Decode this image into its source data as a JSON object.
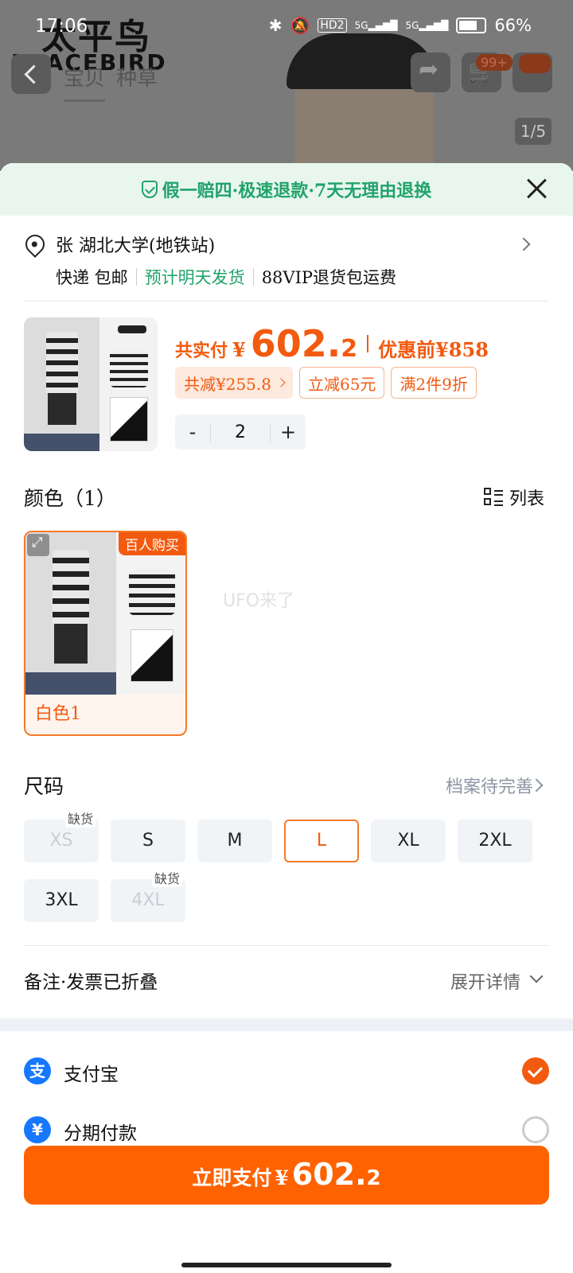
{
  "status_bar": {
    "time": "17:06",
    "battery": "66%",
    "network_labels": [
      "HD2",
      "5G",
      "5G"
    ]
  },
  "background_page": {
    "brand_cn": "太平鸟",
    "brand_en": "PEACEBIRD",
    "tabs": [
      "宝贝",
      "种草"
    ],
    "cart_badge": "99+",
    "image_pager": "1/5"
  },
  "sheet": {
    "guarantee": "假一赔四·极速退款·7天无理由退换",
    "address": {
      "name_and_location": "张 湖北大学(地铁站)",
      "delivery": "快递 包邮",
      "ship_estimate": "预计明天发货",
      "return_policy": "88VIP退货包运费"
    },
    "product": {
      "total_label": "共实付",
      "currency": "¥",
      "total_integer": "602.",
      "total_decimal": "2",
      "original_label": "优惠前",
      "original_price": "¥858",
      "promos": [
        "共减¥255.8",
        "立减65元",
        "满2件9折"
      ],
      "quantity": "2",
      "minus": "-",
      "plus": "+"
    },
    "color_section": {
      "title": "颜色（1）",
      "list_toggle": "列表",
      "options": [
        {
          "name": "白色1",
          "badge": "百人购买",
          "selected": true
        }
      ],
      "watermark": "UFO来了"
    },
    "size_section": {
      "title": "尺码",
      "hint": "档案待完善",
      "out_of_stock_label": "缺货",
      "sizes": [
        {
          "label": "XS",
          "state": "out"
        },
        {
          "label": "S",
          "state": "normal"
        },
        {
          "label": "M",
          "state": "normal"
        },
        {
          "label": "L",
          "state": "selected"
        },
        {
          "label": "XL",
          "state": "normal"
        },
        {
          "label": "2XL",
          "state": "normal"
        },
        {
          "label": "3XL",
          "state": "normal"
        },
        {
          "label": "4XL",
          "state": "out"
        }
      ]
    },
    "remark": {
      "label": "备注·发票已折叠",
      "expand": "展开详情"
    },
    "payment": [
      {
        "label": "支付宝",
        "icon": "alipay-icon",
        "selected": true
      },
      {
        "label": "分期付款",
        "icon": "installment-icon",
        "selected": false
      }
    ],
    "cta": {
      "label": "立即支付",
      "currency": "¥",
      "integer": "602.",
      "decimal": "2"
    }
  },
  "colors": {
    "accent": "#f25a0f",
    "cta": "#ff6200",
    "green": "#21a36a",
    "alipay": "#1677ff"
  }
}
